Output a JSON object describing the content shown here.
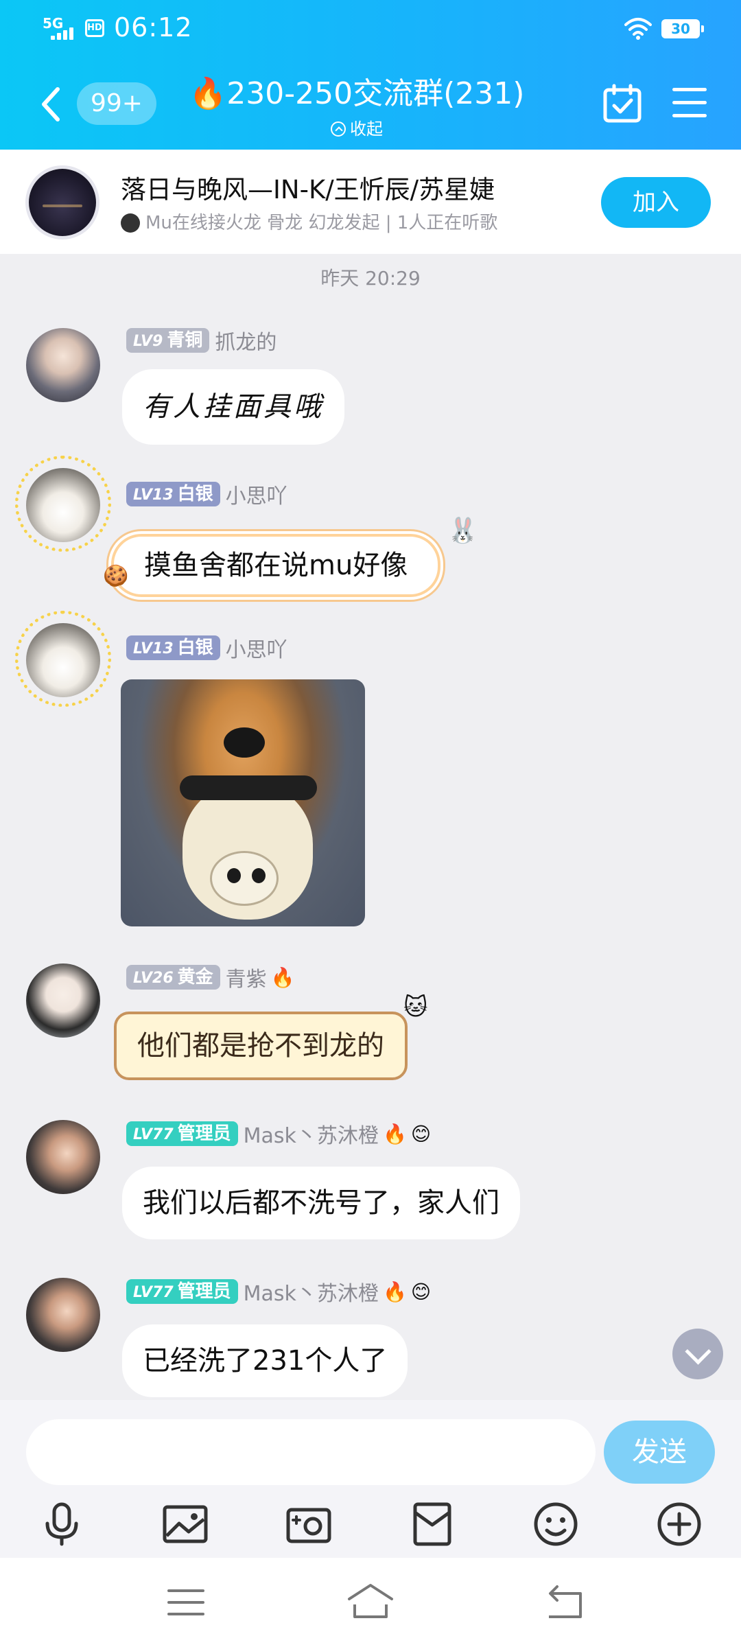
{
  "status_bar": {
    "network": "5G",
    "hd": "HD",
    "time": "06:12",
    "battery": "30"
  },
  "header": {
    "unread_count": "99+",
    "title": "🔥230-250交流群(231)",
    "collapse_label": "收起"
  },
  "music": {
    "title": "落日与晚风—IN-K/王忻辰/苏星婕",
    "subtitle": "Mu在线接火龙 骨龙 幻龙发起 | 1人正在听歌",
    "join_label": "加入"
  },
  "timestamp": "昨天 20:29",
  "messages": [
    {
      "level": "LV9",
      "rank": "青铜",
      "nickname": "抓龙的",
      "text": "有人挂面具哦"
    },
    {
      "level": "LV13",
      "rank": "白银",
      "nickname": "小思吖",
      "text": "摸鱼舍都在说mu好像"
    },
    {
      "level": "LV13",
      "rank": "白银",
      "nickname": "小思吖",
      "text": ""
    },
    {
      "level": "LV26",
      "rank": "黄金",
      "nickname": "青紫",
      "badge": "🔥",
      "text": "他们都是抢不到龙的"
    },
    {
      "level": "LV77",
      "rank": "管理员",
      "nickname": "Mask丶苏沐橙",
      "badge": "🔥",
      "badge2": "😊",
      "text": "我们以后都不洗号了，家人们"
    },
    {
      "level": "LV77",
      "rank": "管理员",
      "nickname": "Mask丶苏沐橙",
      "badge": "🔥",
      "badge2": "😊",
      "text": "已经洗了231个人了"
    }
  ],
  "input": {
    "value": "",
    "send_label": "发送"
  },
  "colors": {
    "header_start": "#0bc7f6",
    "header_end": "#27a3ff",
    "accent": "#12b7f5",
    "send_disabled": "#7fd0f8",
    "admin_badge": "#34cfc0",
    "silver_badge": "#8e99c8"
  },
  "icons": {
    "toolbar": [
      "microphone-icon",
      "image-icon",
      "camera-icon",
      "red-packet-icon",
      "emoji-icon",
      "plus-icon"
    ],
    "nav": [
      "menu-icon",
      "home-icon",
      "back-icon"
    ]
  }
}
